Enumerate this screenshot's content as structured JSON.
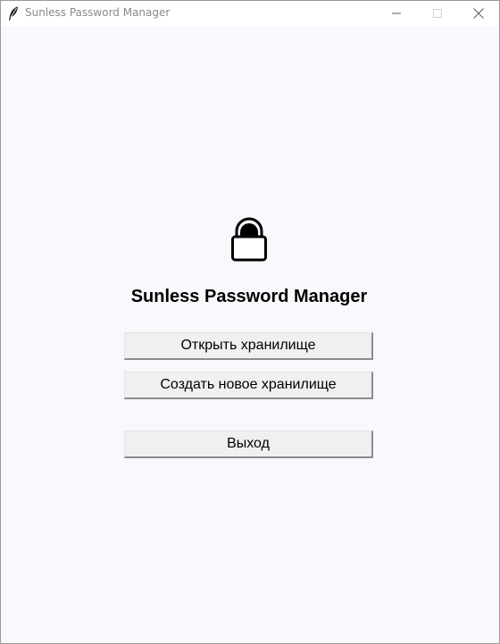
{
  "window": {
    "title": "Sunless Password Manager",
    "app_icon": "feather-icon",
    "controls": {
      "minimize": "minimize-icon",
      "maximize": "maximize-icon",
      "close": "close-icon"
    }
  },
  "main": {
    "icon": "lock-icon",
    "heading": "Sunless Password Manager",
    "buttons": {
      "open_vault": "Открыть хранилище",
      "create_vault": "Создать новое хранилище",
      "exit": "Выход"
    }
  },
  "colors": {
    "background": "#f8f9fc",
    "button_face": "#f0f0f0",
    "title_text": "#8a8a8a"
  }
}
